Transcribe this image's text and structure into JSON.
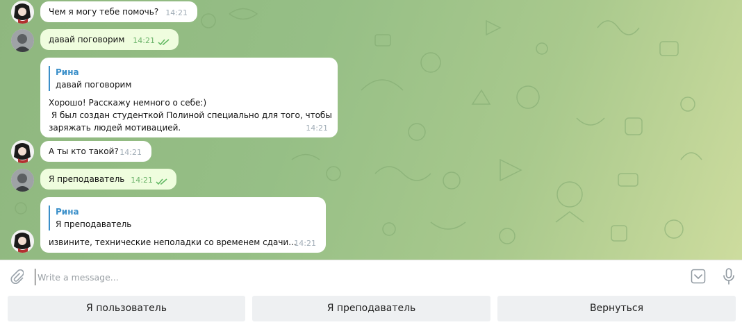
{
  "messages": {
    "m1": {
      "text": "Чем я могу тебе помочь?",
      "time": "14:21"
    },
    "m2": {
      "text": "давай поговорим",
      "time": "14:21"
    },
    "m3": {
      "reply_name": "Рина",
      "reply_text": "давай поговорим",
      "line1": "Хорошо! Расскажу немного о себе:)",
      "line2": " Я был создан студенткой Полиной специально для того, чтобы",
      "line3": "заряжать людей мотивацией.",
      "time": "14:21"
    },
    "m4": {
      "text": "А ты кто такой?",
      "time": "14:21"
    },
    "m5": {
      "text": "Я преподаватель",
      "time": "14:21"
    },
    "m6": {
      "reply_name": "Рина",
      "reply_text": "Я преподаватель",
      "text": "извините, технические неполадки со временем сдачи...",
      "time": "14:21"
    }
  },
  "composer": {
    "placeholder": "Write a message..."
  },
  "keyboard": {
    "btn1": "Я пользователь",
    "btn2": "Я преподаватель",
    "btn3": "Вернуться"
  },
  "colors": {
    "outgoing_bubble": "#effdde",
    "incoming_bubble": "#ffffff",
    "accent": "#3a8fc9",
    "read_checks": "#5fb760"
  }
}
